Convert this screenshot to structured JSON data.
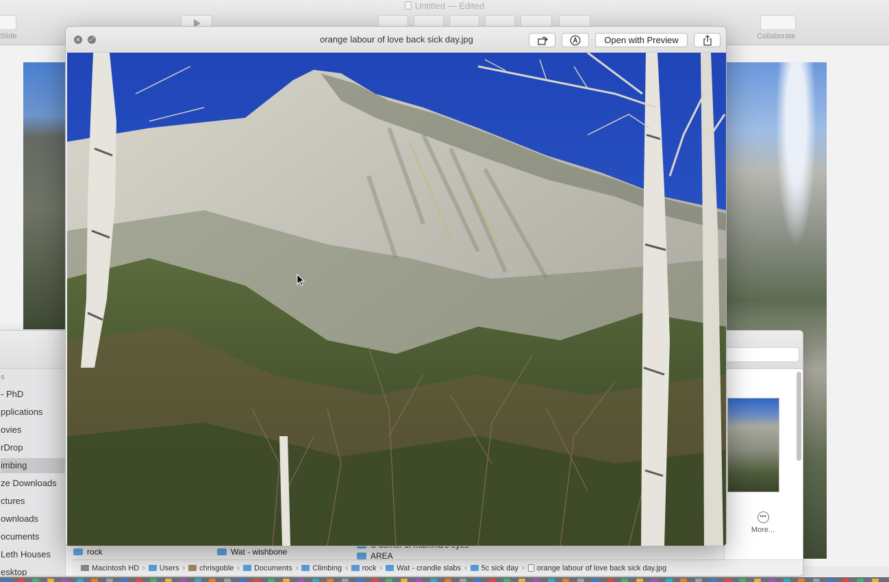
{
  "keynote": {
    "doc_title": "Untitled",
    "doc_status": "— Edited",
    "add_slide_label": "Slide",
    "collaborate_label": "Collaborate"
  },
  "finder": {
    "sidebar_header": "s",
    "sidebar_items": [
      {
        "label": "- PhD"
      },
      {
        "label": "pplications"
      },
      {
        "label": "ovies"
      },
      {
        "label": "rDrop"
      },
      {
        "label": "imbing",
        "selected": true
      },
      {
        "label": "ze Downloads"
      },
      {
        "label": "ctures"
      },
      {
        "label": "ownloads"
      },
      {
        "label": "ocuments"
      },
      {
        "label": "Leth Houses"
      },
      {
        "label": "esktop"
      }
    ],
    "columns": [
      {
        "label": "rock"
      },
      {
        "label": "Wat - wishbone"
      },
      {
        "label": "U corner of mamma's eyes"
      },
      {
        "label": "AREA"
      }
    ],
    "more_label": "More...",
    "path": [
      {
        "label": "Macintosh HD",
        "icon": "disk-icon"
      },
      {
        "label": "Users",
        "icon": "folder-icon"
      },
      {
        "label": "chrisgoble",
        "icon": "home-icon"
      },
      {
        "label": "Documents",
        "icon": "folder-icon"
      },
      {
        "label": "Climbing",
        "icon": "folder-icon"
      },
      {
        "label": "rock",
        "icon": "folder-icon"
      },
      {
        "label": "Wat - crandle slabs",
        "icon": "folder-icon"
      },
      {
        "label": "5c sick day",
        "icon": "folder-icon"
      },
      {
        "label": "orange labour of love back sick day.jpg",
        "icon": "file-icon"
      }
    ]
  },
  "quicklook": {
    "title": "orange labour of love back sick day.jpg",
    "close_icon": "close-icon",
    "fullscreen_icon": "fullscreen-icon",
    "rotate_icon": "rotate-icon",
    "markup_icon": "markup-icon",
    "open_with_label": "Open with Preview",
    "share_icon": "share-icon"
  },
  "colors": {
    "sky": "#2a55c4",
    "rock": "#c9c7bb",
    "foliage": "#3f5a2a",
    "birch": "#e6e4dc"
  }
}
